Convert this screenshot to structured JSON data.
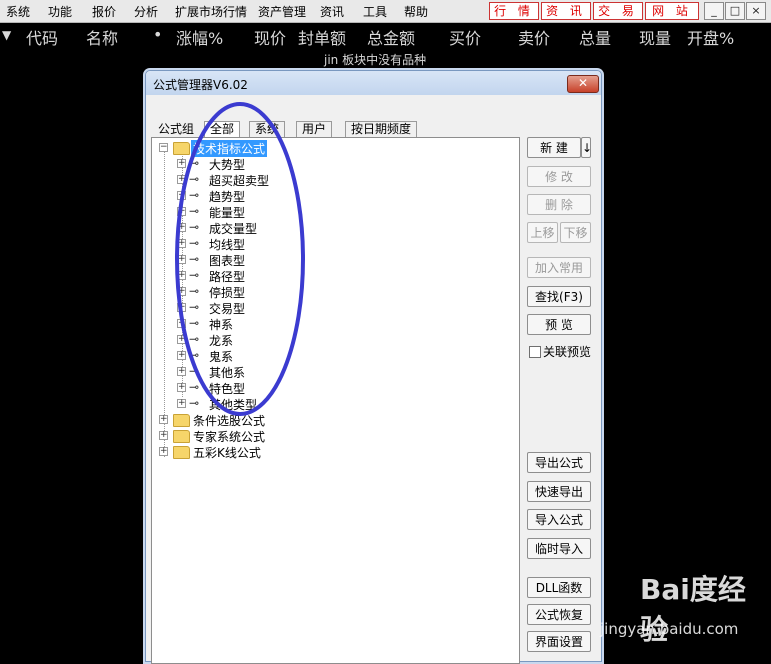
{
  "menubar": {
    "items": [
      "系统",
      "功能",
      "报价",
      "分析",
      "扩展市场行情",
      "资产管理",
      "资讯",
      "工具",
      "帮助"
    ],
    "links": [
      "行 情",
      "资 讯",
      "交 易",
      "网 站"
    ],
    "window_buttons": [
      "_",
      "□",
      "×"
    ]
  },
  "quote_header": {
    "columns": [
      "代码",
      "名称",
      "•",
      "涨幅%",
      "现价",
      "封单额",
      "总金额",
      "买价",
      "卖价",
      "总量",
      "现量",
      "开盘%"
    ],
    "status": "jin 板块中没有品种"
  },
  "dialog": {
    "title": "公式管理器V6.02",
    "close": "✕",
    "tabs_label": "公式组",
    "tabs": [
      "全部",
      "系统",
      "用户",
      "按日期频度"
    ],
    "tree": {
      "root": "技术指标公式",
      "children": [
        "大势型",
        "超买超卖型",
        "趋势型",
        "能量型",
        "成交量型",
        "均线型",
        "图表型",
        "路径型",
        "停损型",
        "交易型",
        "神系",
        "龙系",
        "鬼系",
        "其他系",
        "特色型",
        "其他类型"
      ],
      "others": [
        "条件选股公式",
        "专家系统公式",
        "五彩K线公式"
      ]
    },
    "buttons": {
      "new": "新 建",
      "new_arrow": "↓",
      "modify": "修 改",
      "delete": "删 除",
      "move_up": "上移",
      "move_down": "下移",
      "add_common": "加入常用",
      "find": "查找(F3)",
      "preview": "预 览",
      "related_preview": "关联预览",
      "export": "导出公式",
      "quick_export": "快速导出",
      "import": "导入公式",
      "temp_import": "临时导入",
      "dll": "DLL函数",
      "restore": "公式恢复",
      "ui_settings": "界面设置"
    }
  },
  "watermark": {
    "text": "Bai度经验",
    "url": "jingyan.baidu.com"
  },
  "colors": {
    "annotation": "#3b3bd0",
    "selection": "#3399ff",
    "link_red": "#dd0000"
  }
}
